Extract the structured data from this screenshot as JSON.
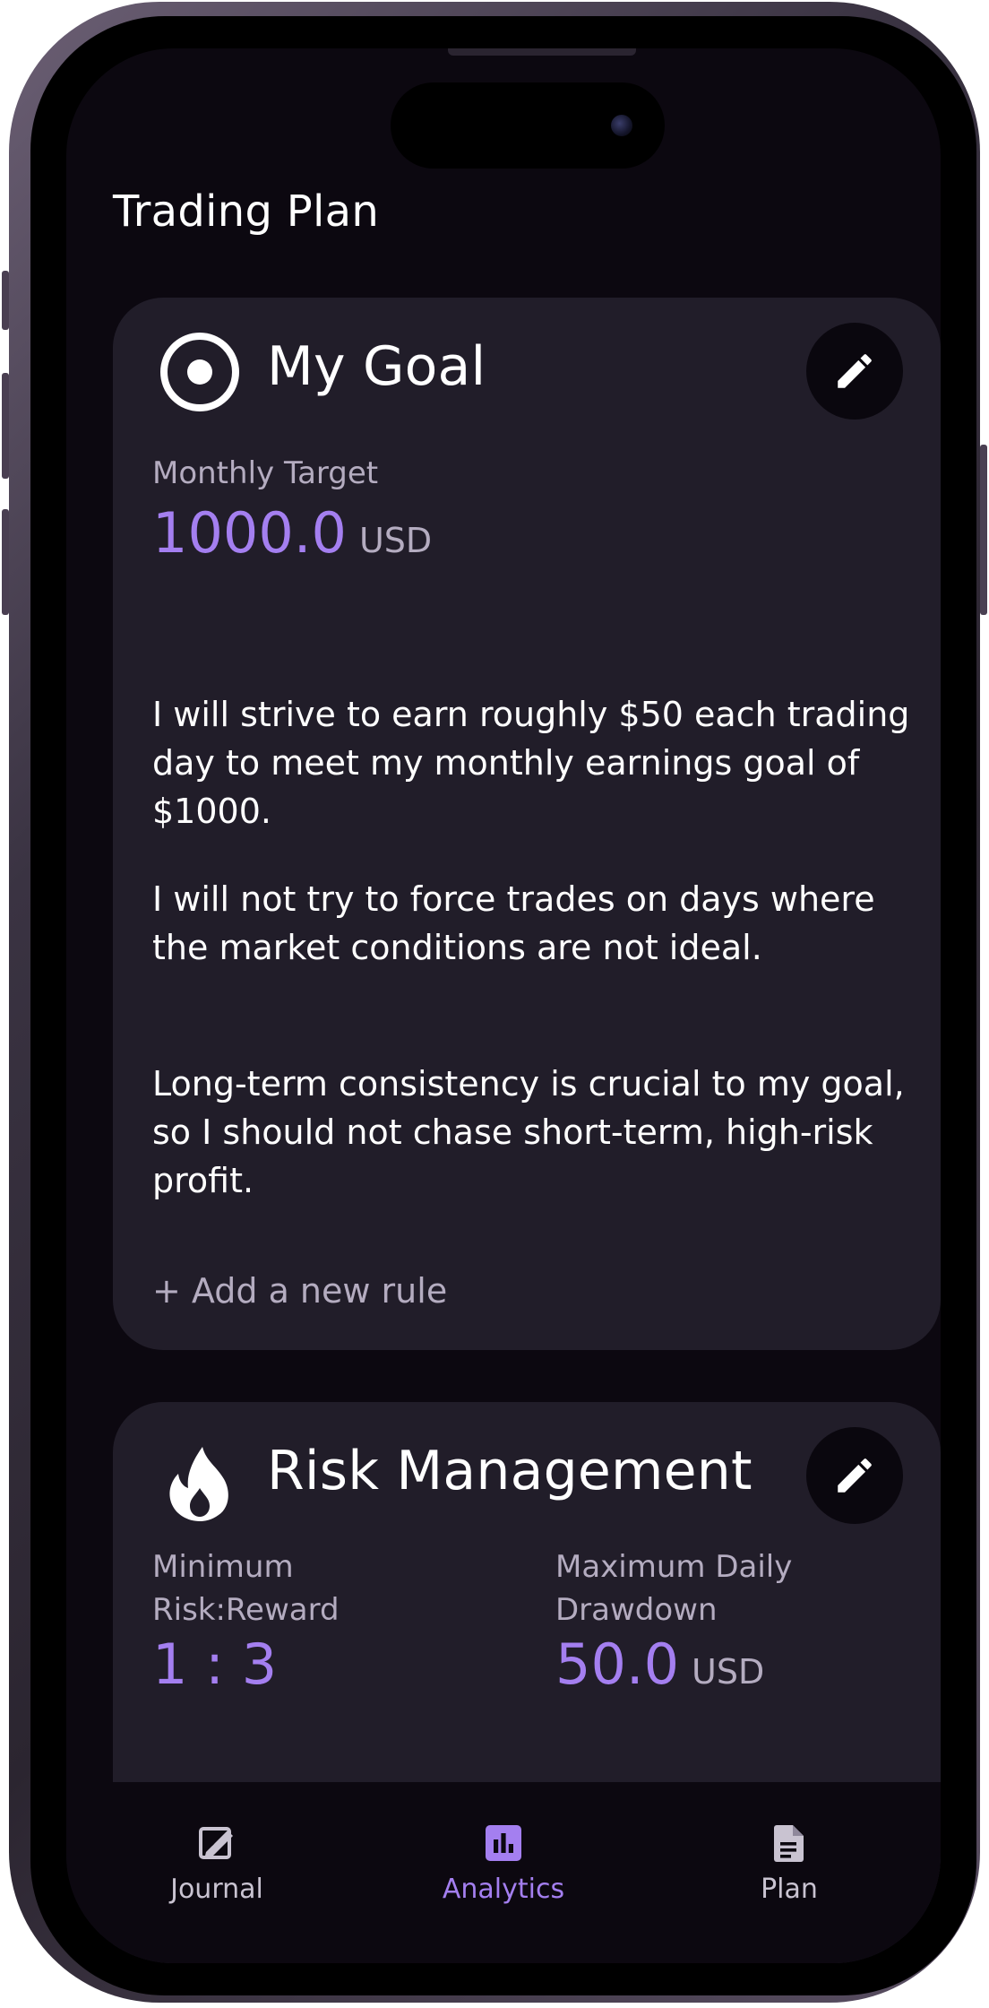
{
  "page": {
    "title": "Trading Plan"
  },
  "goal_card": {
    "title": "My Goal",
    "icon": "target-icon",
    "monthly_target_label": "Monthly Target",
    "monthly_target_value": "1000.0",
    "monthly_target_unit": "USD",
    "rules": [
      "I will strive to earn roughly $50 each trading day to meet my monthly earnings goal of $1000.",
      "I will not try to force trades on days where the market conditions are not ideal.",
      "Long-term consistency is crucial to my goal, so I should not chase short-term, high-risk profit."
    ],
    "add_rule_label": "+ Add a new rule"
  },
  "risk_card": {
    "title": "Risk Management",
    "icon": "fire-icon",
    "min_rr_label_line1": "Minimum",
    "min_rr_label_line2": "Risk:Reward",
    "min_rr_value": "1 : 3",
    "max_dd_label_line1": "Maximum Daily",
    "max_dd_label_line2": "Drawdown",
    "max_dd_value": "50.0",
    "max_dd_unit": "USD"
  },
  "nav": {
    "items": [
      {
        "label": "Journal",
        "icon": "journal-icon",
        "active": false
      },
      {
        "label": "Analytics",
        "icon": "analytics-icon",
        "active": true
      },
      {
        "label": "Plan",
        "icon": "document-icon",
        "active": false
      }
    ]
  },
  "colors": {
    "background": "#0c0810",
    "card": "#211d29",
    "accent": "#a47ff0",
    "muted_text": "#b4acc0",
    "text": "#ffffff"
  }
}
